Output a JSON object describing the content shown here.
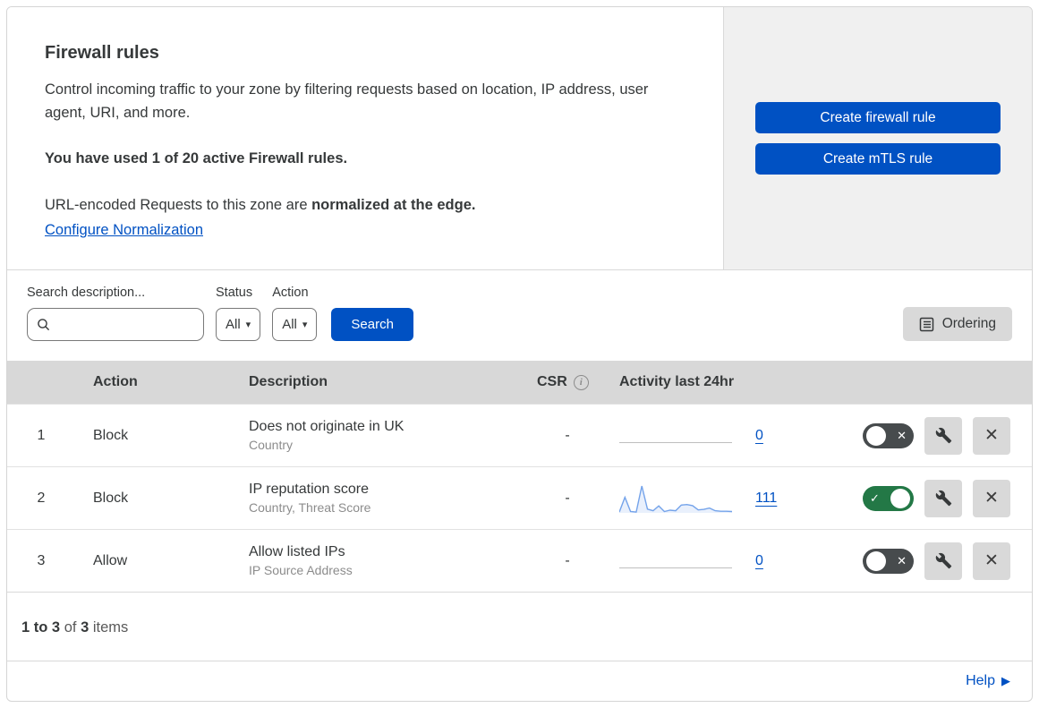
{
  "header": {
    "title": "Firewall rules",
    "description": "Control incoming traffic to your zone by filtering requests based on location, IP address, user agent, URI, and more.",
    "usage_text": "You have used 1 of 20 active Firewall rules.",
    "normalization_prefix": "URL-encoded Requests to this zone are ",
    "normalization_bold": "normalized at the edge.",
    "normalization_link": "Configure Normalization"
  },
  "actions_panel": {
    "create_firewall_button": "Create firewall rule",
    "create_mtls_button": "Create mTLS rule"
  },
  "filters": {
    "search_label": "Search description...",
    "status_label": "Status",
    "status_value": "All",
    "action_label": "Action",
    "action_value": "All",
    "search_button": "Search",
    "ordering_button": "Ordering"
  },
  "table": {
    "columns": {
      "action": "Action",
      "description": "Description",
      "csr": "CSR",
      "activity": "Activity last 24hr"
    },
    "rows": [
      {
        "index": "1",
        "action": "Block",
        "description": "Does not originate in UK",
        "criteria": "Country",
        "csr": "-",
        "activity_count": "0",
        "enabled": false
      },
      {
        "index": "2",
        "action": "Block",
        "description": "IP reputation score",
        "criteria": "Country, Threat Score",
        "csr": "-",
        "activity_count": "111",
        "enabled": true
      },
      {
        "index": "3",
        "action": "Allow",
        "description": "Allow listed IPs",
        "criteria": "IP Source Address",
        "csr": "-",
        "activity_count": "0",
        "enabled": false
      }
    ]
  },
  "chart_data": {
    "type": "area",
    "title": "Activity last 24hr - rule 2 (IP reputation score)",
    "values": [
      3,
      58,
      5,
      3,
      100,
      14,
      8,
      26,
      5,
      10,
      8,
      29,
      31,
      27,
      11,
      13,
      18,
      8,
      6,
      6,
      5
    ],
    "total": 111,
    "ylim": [
      0,
      100
    ],
    "color": "#74a3ea",
    "fill": "rgba(116,163,234,0.16)"
  },
  "footer": {
    "summary_range": "1 to 3",
    "summary_of": "of",
    "summary_total": "3",
    "summary_items": "items",
    "help_label": "Help"
  },
  "colors": {
    "accent_blue": "#0051c3",
    "toggle_on_green": "#237846",
    "toggle_off_gray": "#474b4d",
    "panel_gray": "#f0f0f0",
    "table_header_gray": "#d8d8d8"
  }
}
